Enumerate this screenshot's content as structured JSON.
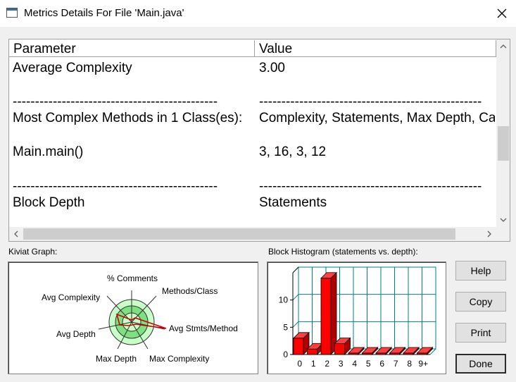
{
  "window": {
    "title": "Metrics Details For File 'Main.java'"
  },
  "table": {
    "columns": [
      "Parameter",
      "Value"
    ],
    "rows": [
      {
        "parameter": "Average Complexity",
        "value": "3.00"
      },
      {
        "parameter": "",
        "value": ""
      },
      {
        "parameter": "----------------------------------------------",
        "value": "--------------------------------------------------"
      },
      {
        "parameter": "Most Complex Methods in 1 Class(es):",
        "value": "Complexity, Statements, Max Depth, Calls"
      },
      {
        "parameter": "Main.main()",
        "value": "3, 16, 3, 12"
      },
      {
        "parameter": "----------------------------------------------",
        "value": "--------------------------------------------------"
      },
      {
        "parameter": "Block Depth",
        "value": "Statements"
      }
    ]
  },
  "kiviat": {
    "group_label": "Kiviat Graph:",
    "axes": [
      "% Comments",
      "Methods/Class",
      "Avg Stmts/Method",
      "Max Complexity",
      "Max Depth",
      "Avg Depth",
      "Avg Complexity"
    ],
    "colors": {
      "outer_ring": "#c8ffc8",
      "middle_ring": "#7fe07f",
      "inner_disc": "#c8ffc8",
      "polygon": "#cc0000"
    }
  },
  "histogram": {
    "group_label": "Block Histogram (statements vs. depth):",
    "chart_data": {
      "type": "bar",
      "categories": [
        "0",
        "1",
        "2",
        "3",
        "4",
        "5",
        "6",
        "7",
        "8",
        "9+"
      ],
      "values": [
        3,
        1,
        14,
        2,
        0,
        0,
        0,
        0,
        0,
        0
      ],
      "y_ticks": [
        "0",
        "5",
        "10"
      ],
      "ylim": [
        0,
        15
      ],
      "grid": true,
      "bar_color": "#ff0000",
      "grid_color": "#008080"
    }
  },
  "buttons": {
    "help": "Help",
    "copy": "Copy",
    "print": "Print",
    "done": "Done"
  }
}
